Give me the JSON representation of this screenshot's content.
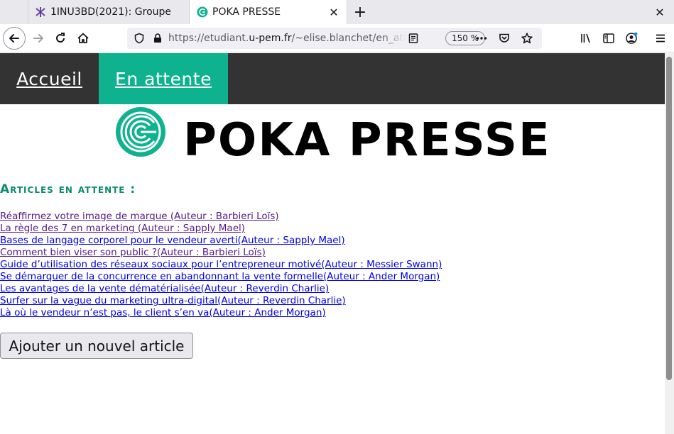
{
  "browser": {
    "tabs": [
      {
        "title": "1INU3BD(2021): Groupe",
        "icon": "moodle-icon",
        "active": false
      },
      {
        "title": "POKA PRESSE",
        "icon": "poka-favicon",
        "active": true
      }
    ],
    "url_prefix": "https://etudiant.",
    "url_host": "u-pem.fr",
    "url_path": "/~elise.blanchet/en_att",
    "zoom": "150 %"
  },
  "site": {
    "nav": [
      {
        "label": "Accueil",
        "active": false
      },
      {
        "label": "En attente",
        "active": true
      }
    ],
    "title": "POKA PRESSE",
    "section_title": "Articles en attente :",
    "articles": [
      {
        "label": "Réaffirmez votre image de marque (Auteur : Barbieri Loïs)",
        "visited": true
      },
      {
        "label": "La règle des 7 en marketing (Auteur : Sapply Mael)",
        "visited": true
      },
      {
        "label": "Bases de langage corporel pour le vendeur averti(Auteur : Sapply Mael)",
        "visited": false
      },
      {
        "label": "Comment bien viser son public ?(Auteur : Barbieri Loïs)",
        "visited": true
      },
      {
        "label": "Guide d’utilisation des réseaux sociaux pour l’entrepreneur motivé(Auteur : Messier Swann)",
        "visited": false
      },
      {
        "label": "Se démarquer de la concurrence en abandonnant la vente formelle(Auteur : Ander Morgan)",
        "visited": false
      },
      {
        "label": "Les avantages de la vente dématérialisée(Auteur : Reverdin Charlie)",
        "visited": false
      },
      {
        "label": "Surfer sur la vague du marketing ultra-digital(Auteur : Reverdin Charlie)",
        "visited": false
      },
      {
        "label": "Là où le vendeur n’est pas, le client s’en va(Auteur : Ander Morgan)",
        "visited": false
      }
    ],
    "add_button": "Ajouter un nouvel article"
  },
  "colors": {
    "nav_bg": "#333333",
    "accent": "#0fb28f",
    "section_title": "#0a8a6e",
    "link": "#0000ee",
    "link_visited": "#551a8b"
  }
}
